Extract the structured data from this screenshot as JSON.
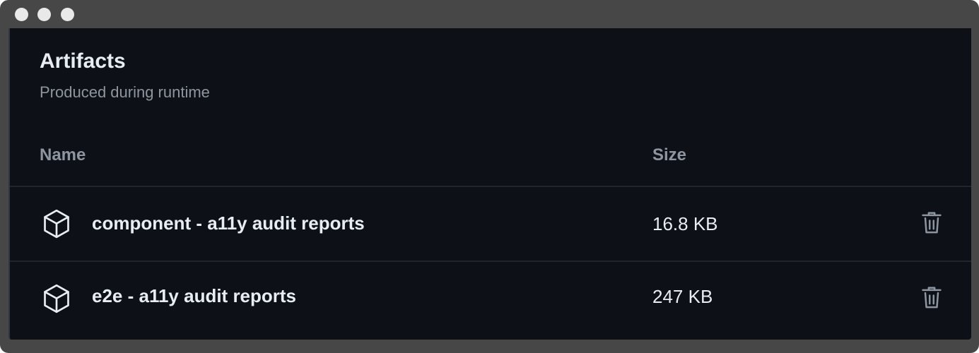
{
  "section": {
    "title": "Artifacts",
    "subtitle": "Produced during runtime"
  },
  "table": {
    "headers": {
      "name": "Name",
      "size": "Size"
    },
    "rows": [
      {
        "name": "component - a11y audit reports",
        "size": "16.8 KB",
        "icon": "package-icon",
        "action_icon": "trash-icon"
      },
      {
        "name": "e2e - a11y audit reports",
        "size": "247 KB",
        "icon": "package-icon",
        "action_icon": "trash-icon"
      }
    ]
  },
  "colors": {
    "background": "#0d1117",
    "text_primary": "#e6edf3",
    "text_muted": "#8d96a0",
    "border": "#21262d",
    "window_frame": "#474747"
  }
}
